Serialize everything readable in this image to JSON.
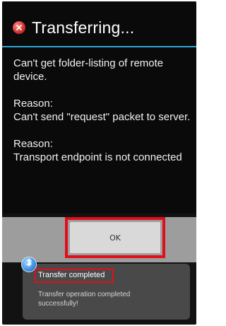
{
  "dialog": {
    "title": "Transferring...",
    "status_icon": "error-icon",
    "message": "Can't get folder-listing of remote device.",
    "reason_1_label": "Reason:",
    "reason_1_text": "Can't send \"request\" packet to server.",
    "reason_2_label": "Reason:",
    "reason_2_text": "Transport endpoint is not connected",
    "ok_label": "OK"
  },
  "toast": {
    "icon": "bluetooth-icon",
    "title": "Transfer completed",
    "message": "Transfer operation completed successfully!"
  },
  "colors": {
    "accent_divider": "#2fa6d8",
    "highlight_red": "#e10e1a",
    "dialog_bg": "#0a0a0a",
    "button_bar_bg": "#9d9d9d"
  }
}
